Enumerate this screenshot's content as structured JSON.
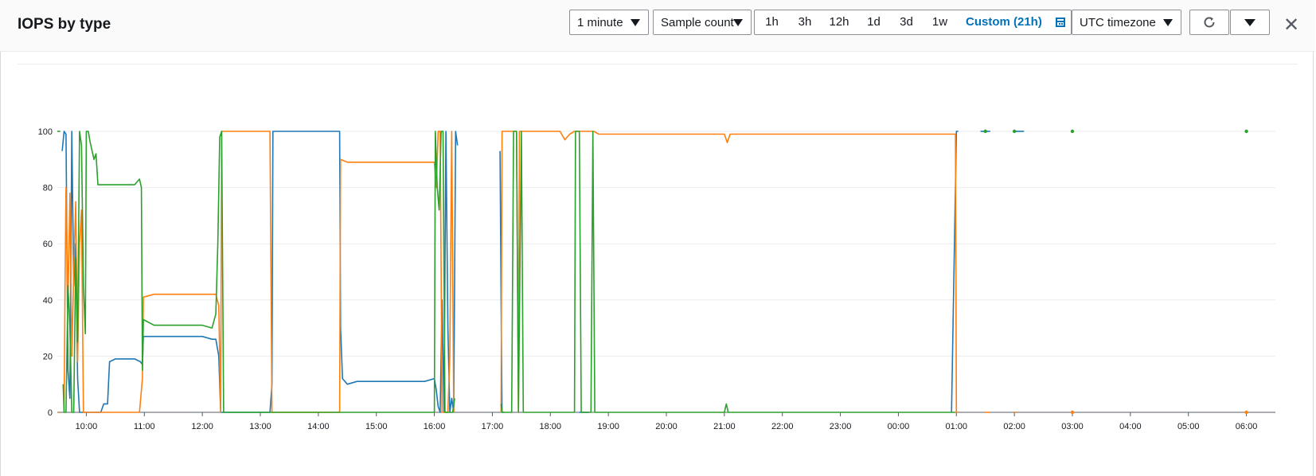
{
  "widget": {
    "title": "IOPS by type",
    "period": "1 minute",
    "statistic": "Sample count",
    "ranges": [
      "1h",
      "3h",
      "12h",
      "1d",
      "3d",
      "1w"
    ],
    "custom_range": "Custom (21h)",
    "timezone": "UTC timezone",
    "refresh_icon": "refresh-icon",
    "more_icon": "caret-down-icon",
    "close_icon": "close-icon"
  },
  "colors": {
    "series_blue": "#1f77b4",
    "series_orange": "#ff7f0e",
    "series_green": "#2ca02c",
    "grid": "#e9ebed",
    "axis": "#545b64"
  },
  "chart_data": {
    "type": "line",
    "title": "IOPS by type",
    "xlabel": "",
    "ylabel": "",
    "ylim": [
      0,
      100
    ],
    "yticks": [
      0,
      20,
      40,
      60,
      80,
      100
    ],
    "xlim": [
      "09:30",
      "06:30"
    ],
    "xticks": [
      "10:00",
      "11:00",
      "12:00",
      "13:00",
      "14:00",
      "15:00",
      "16:00",
      "17:00",
      "18:00",
      "19:00",
      "20:00",
      "21:00",
      "22:00",
      "23:00",
      "00:00",
      "01:00",
      "02:00",
      "03:00",
      "04:00",
      "05:00",
      "06:00"
    ],
    "grid": true,
    "legend": "none",
    "series": [
      {
        "color": "#1f77b4",
        "points": [
          [
            "09:35",
            93
          ],
          [
            "09:37",
            100
          ],
          [
            "09:39",
            99
          ],
          [
            "09:41",
            15
          ],
          [
            "09:43",
            5
          ],
          [
            "09:45",
            100
          ],
          [
            "09:47",
            45
          ],
          [
            "09:49",
            60
          ],
          [
            "09:51",
            12
          ],
          [
            "09:53",
            0
          ],
          [
            "09:55",
            0
          ],
          [
            "10:00",
            0
          ],
          [
            "10:05",
            0
          ],
          [
            "10:10",
            0
          ],
          [
            "10:15",
            0
          ],
          [
            "10:18",
            3
          ],
          [
            "10:22",
            3
          ],
          [
            "10:24",
            18
          ],
          [
            "10:30",
            19
          ],
          [
            "10:40",
            19
          ],
          [
            "10:50",
            19
          ],
          [
            "10:56",
            18
          ],
          [
            "10:58",
            17
          ],
          [
            "10:59",
            27
          ],
          [
            "11:10",
            27
          ],
          [
            "11:20",
            27
          ],
          [
            "11:30",
            27
          ],
          [
            "11:40",
            27
          ],
          [
            "11:50",
            27
          ],
          [
            "12:00",
            27
          ],
          [
            "12:10",
            26
          ],
          [
            "12:14",
            26
          ],
          [
            "12:17",
            20
          ],
          [
            "12:19",
            0
          ],
          [
            "12:30",
            0
          ],
          [
            "12:45",
            0
          ],
          [
            "13:00",
            0
          ],
          [
            "13:10",
            0
          ],
          [
            "13:12",
            10
          ],
          [
            "13:13",
            100
          ],
          [
            "13:30",
            100
          ],
          [
            "13:45",
            100
          ],
          [
            "14:00",
            100
          ],
          [
            "14:15",
            100
          ],
          [
            "14:22",
            100
          ],
          [
            "14:23",
            30
          ],
          [
            "14:25",
            12
          ],
          [
            "14:30",
            10
          ],
          [
            "14:40",
            11
          ],
          [
            "14:50",
            11
          ],
          [
            "15:00",
            11
          ],
          [
            "15:10",
            11
          ],
          [
            "15:20",
            11
          ],
          [
            "15:30",
            11
          ],
          [
            "15:40",
            11
          ],
          [
            "15:50",
            11
          ],
          [
            "16:00",
            12
          ],
          [
            "16:02",
            8
          ],
          [
            "16:04",
            2
          ],
          [
            "16:06",
            0
          ],
          [
            "16:08",
            40
          ],
          [
            "16:10",
            0
          ],
          [
            "16:12",
            100
          ],
          [
            "16:14",
            30
          ],
          [
            "16:16",
            0
          ],
          [
            "16:18",
            5
          ],
          [
            "16:20",
            0
          ],
          [
            "16:22",
            100
          ],
          [
            "16:24",
            95
          ],
          null,
          [
            "17:08",
            93
          ],
          [
            "17:09",
            40
          ],
          [
            "17:10",
            0
          ],
          [
            "17:12",
            0
          ],
          null,
          [
            "18:30",
            0
          ],
          [
            "18:40",
            0
          ],
          null,
          [
            "00:55",
            0
          ],
          [
            "01:00",
            100
          ],
          [
            "01:02",
            100
          ],
          null,
          [
            "01:25",
            100
          ],
          [
            "01:35",
            100
          ],
          null,
          [
            "02:00",
            100
          ],
          [
            "02:10",
            100
          ]
        ]
      },
      {
        "color": "#ff7f0e",
        "points": [
          [
            "09:31",
            0
          ],
          [
            "09:33",
            0
          ],
          null,
          [
            "09:36",
            0
          ],
          [
            "09:37",
            0
          ],
          [
            "09:38",
            45
          ],
          [
            "09:39",
            80
          ],
          [
            "09:41",
            38
          ],
          [
            "09:43",
            78
          ],
          [
            "09:45",
            20
          ],
          [
            "09:47",
            50
          ],
          [
            "09:49",
            75
          ],
          [
            "09:51",
            18
          ],
          [
            "09:53",
            60
          ],
          [
            "09:55",
            72
          ],
          [
            "09:57",
            0
          ],
          [
            "10:00",
            0
          ],
          [
            "10:10",
            0
          ],
          [
            "10:20",
            0
          ],
          [
            "10:30",
            0
          ],
          [
            "10:40",
            0
          ],
          [
            "10:50",
            0
          ],
          [
            "10:55",
            0
          ],
          [
            "10:58",
            12
          ],
          [
            "10:59",
            41
          ],
          [
            "11:10",
            42
          ],
          [
            "11:20",
            42
          ],
          [
            "11:30",
            42
          ],
          [
            "11:40",
            42
          ],
          [
            "11:50",
            42
          ],
          [
            "12:00",
            42
          ],
          [
            "12:10",
            42
          ],
          [
            "12:14",
            42
          ],
          [
            "12:17",
            38
          ],
          [
            "12:19",
            0
          ],
          [
            "12:20",
            100
          ],
          [
            "12:30",
            100
          ],
          [
            "12:45",
            100
          ],
          [
            "13:00",
            100
          ],
          [
            "13:10",
            100
          ],
          [
            "13:12",
            0
          ],
          [
            "13:13",
            0
          ],
          [
            "13:30",
            0
          ],
          [
            "13:45",
            0
          ],
          [
            "14:00",
            0
          ],
          [
            "14:15",
            0
          ],
          [
            "14:22",
            0
          ],
          [
            "14:23",
            90
          ],
          [
            "14:30",
            89
          ],
          [
            "14:40",
            89
          ],
          [
            "14:50",
            89
          ],
          [
            "15:00",
            89
          ],
          [
            "15:10",
            89
          ],
          [
            "15:20",
            89
          ],
          [
            "15:30",
            89
          ],
          [
            "15:40",
            89
          ],
          [
            "15:50",
            89
          ],
          [
            "16:00",
            89
          ],
          [
            "16:02",
            80
          ],
          [
            "16:04",
            100
          ],
          [
            "16:06",
            100
          ],
          [
            "16:08",
            0
          ],
          [
            "16:10",
            0
          ],
          [
            "16:12",
            0
          ],
          [
            "16:14",
            0
          ],
          [
            "16:16",
            20
          ],
          [
            "16:18",
            100
          ],
          [
            "16:20",
            0
          ],
          null,
          [
            "17:09",
            0
          ],
          [
            "17:10",
            100
          ],
          [
            "17:12",
            100
          ],
          [
            "17:20",
            100
          ],
          [
            "17:25",
            100
          ],
          [
            "17:27",
            0
          ],
          [
            "17:28",
            100
          ],
          [
            "17:35",
            100
          ],
          [
            "17:40",
            100
          ],
          [
            "18:00",
            100
          ],
          [
            "18:10",
            100
          ],
          [
            "18:15",
            97
          ],
          [
            "18:20",
            99
          ],
          [
            "18:25",
            100
          ],
          [
            "18:30",
            100
          ],
          [
            "18:40",
            100
          ],
          [
            "18:45",
            100
          ],
          [
            "18:50",
            99
          ],
          [
            "19:00",
            99
          ],
          [
            "19:30",
            99
          ],
          [
            "20:00",
            99
          ],
          [
            "20:30",
            99
          ],
          [
            "21:00",
            99
          ],
          [
            "21:03",
            96
          ],
          [
            "21:06",
            99
          ],
          [
            "21:30",
            99
          ],
          [
            "22:00",
            99
          ],
          [
            "22:30",
            99
          ],
          [
            "23:00",
            99
          ],
          [
            "23:30",
            99
          ],
          [
            "00:00",
            99
          ],
          [
            "00:30",
            99
          ],
          [
            "00:55",
            99
          ],
          [
            "00:59",
            99
          ],
          [
            "01:00",
            0
          ],
          [
            "01:02",
            0
          ],
          null,
          [
            "01:30",
            0
          ],
          [
            "01:35",
            0
          ],
          null,
          [
            "02:00",
            0
          ],
          [
            "02:02",
            0
          ],
          null,
          [
            "03:00",
            0
          ],
          null,
          [
            "06:00",
            0
          ]
        ]
      },
      {
        "color": "#2ca02c",
        "points": [
          [
            "09:30",
            100
          ],
          [
            "09:31",
            100
          ],
          [
            "09:33",
            100
          ],
          null,
          [
            "09:36",
            10
          ],
          [
            "09:37",
            0
          ],
          [
            "09:39",
            0
          ],
          [
            "09:41",
            45
          ],
          [
            "09:43",
            30
          ],
          [
            "09:45",
            0
          ],
          [
            "09:47",
            0
          ],
          [
            "09:49",
            55
          ],
          [
            "09:51",
            25
          ],
          [
            "09:53",
            100
          ],
          [
            "09:55",
            95
          ],
          [
            "09:57",
            45
          ],
          [
            "09:59",
            28
          ],
          [
            "10:00",
            100
          ],
          [
            "10:02",
            100
          ],
          [
            "10:04",
            96
          ],
          [
            "10:08",
            90
          ],
          [
            "10:10",
            92
          ],
          [
            "10:12",
            81
          ],
          [
            "10:20",
            81
          ],
          [
            "10:30",
            81
          ],
          [
            "10:40",
            81
          ],
          [
            "10:50",
            81
          ],
          [
            "10:55",
            83
          ],
          [
            "10:57",
            80
          ],
          [
            "10:58",
            15
          ],
          [
            "10:59",
            33
          ],
          [
            "11:10",
            31
          ],
          [
            "11:20",
            31
          ],
          [
            "11:30",
            31
          ],
          [
            "11:40",
            31
          ],
          [
            "11:50",
            31
          ],
          [
            "12:00",
            31
          ],
          [
            "12:10",
            30
          ],
          [
            "12:14",
            35
          ],
          [
            "12:16",
            60
          ],
          [
            "12:18",
            98
          ],
          [
            "12:20",
            100
          ],
          [
            "12:22",
            0
          ],
          [
            "12:30",
            0
          ],
          [
            "12:45",
            0
          ],
          [
            "13:00",
            0
          ],
          [
            "13:10",
            0
          ],
          [
            "13:12",
            0
          ],
          [
            "13:30",
            0
          ],
          [
            "14:00",
            0
          ],
          [
            "14:22",
            0
          ],
          [
            "14:23",
            0
          ],
          [
            "14:40",
            0
          ],
          [
            "15:00",
            0
          ],
          [
            "15:20",
            0
          ],
          [
            "15:40",
            0
          ],
          [
            "15:55",
            0
          ],
          [
            "16:00",
            0
          ],
          [
            "16:01",
            100
          ],
          [
            "16:03",
            80
          ],
          [
            "16:05",
            72
          ],
          [
            "16:07",
            100
          ],
          [
            "16:09",
            100
          ],
          [
            "16:11",
            0
          ],
          [
            "16:13",
            0
          ],
          [
            "16:15",
            0
          ],
          [
            "16:17",
            0
          ],
          [
            "16:19",
            0
          ],
          [
            "16:21",
            5
          ],
          null,
          [
            "17:09",
            3
          ],
          [
            "17:10",
            0
          ],
          [
            "17:18",
            0
          ],
          [
            "17:20",
            0
          ],
          [
            "17:22",
            100
          ],
          [
            "17:25",
            100
          ],
          [
            "17:27",
            0
          ],
          [
            "17:30",
            100
          ],
          [
            "17:32",
            0
          ],
          [
            "18:00",
            0
          ],
          [
            "18:10",
            0
          ],
          [
            "18:20",
            0
          ],
          [
            "18:25",
            0
          ],
          [
            "18:26",
            100
          ],
          [
            "18:30",
            100
          ],
          [
            "18:32",
            0
          ],
          [
            "18:42",
            0
          ],
          [
            "18:44",
            100
          ],
          [
            "18:46",
            0
          ],
          [
            "19:00",
            0
          ],
          [
            "19:30",
            0
          ],
          [
            "20:00",
            0
          ],
          [
            "20:30",
            0
          ],
          [
            "21:00",
            0
          ],
          [
            "21:02",
            3
          ],
          [
            "21:04",
            0
          ],
          [
            "21:30",
            0
          ],
          [
            "22:00",
            0
          ],
          [
            "22:30",
            0
          ],
          [
            "23:00",
            0
          ],
          [
            "23:30",
            0
          ],
          [
            "00:00",
            0
          ],
          [
            "00:30",
            0
          ],
          [
            "00:59",
            0
          ],
          null,
          [
            "01:30",
            100
          ],
          null,
          [
            "02:00",
            100
          ],
          null,
          [
            "03:00",
            100
          ],
          null,
          [
            "06:00",
            100
          ]
        ]
      }
    ]
  }
}
